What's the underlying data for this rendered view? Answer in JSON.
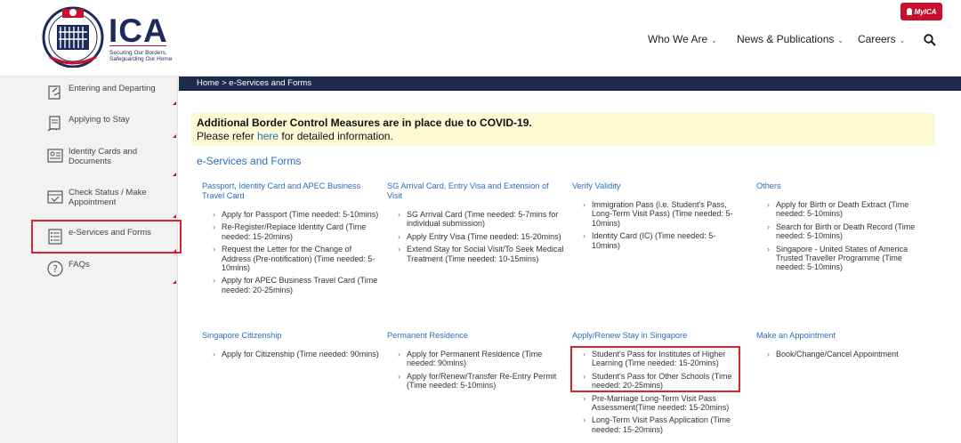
{
  "header": {
    "logo_text": "ICA",
    "tagline": "Securing Our Borders, Safeguarding Our Home",
    "myica_label": "MyICA",
    "nav": [
      {
        "label": "Who We Are"
      },
      {
        "label": "News & Publications"
      },
      {
        "label": "Careers"
      }
    ]
  },
  "sidebar": {
    "items": [
      {
        "label": "Entering and Departing"
      },
      {
        "label": "Applying to Stay"
      },
      {
        "label": "Identity Cards and Documents"
      },
      {
        "label": "Check Status / Make Appointment"
      },
      {
        "label": "e-Services and Forms"
      },
      {
        "label": "FAQs"
      }
    ]
  },
  "breadcrumb": "Home > e-Services and Forms",
  "alert": {
    "title": "Additional Border Control Measures are in place due to COVID-19.",
    "prefix": "Please refer ",
    "link": "here",
    "suffix": " for detailed information."
  },
  "section_title": "e-Services and Forms",
  "columns": [
    {
      "heading": "Passport, Identity Card and APEC Business Travel Card",
      "items": [
        "Apply for Passport (Time needed: 5-10mins)",
        "Re-Register/Replace Identity Card (Time needed: 15-20mins)",
        "Request the Letter for the Change of Address (Pre-notification) (Time needed: 5-10mins)",
        "Apply for APEC Business Travel Card (Time needed: 20-25mins)"
      ]
    },
    {
      "heading": "SG Arrival Card, Entry Visa and Extension of Visit",
      "items": [
        "SG Arrival Card (Time needed: 5-7mins for individual submission)",
        "Apply Entry Visa (Time needed: 15-20mins)",
        "Extend Stay for Social Visit/To Seek Medical Treatment (Time needed: 10-15mins)"
      ]
    },
    {
      "heading": "Verify Validity",
      "items": [
        "Immigration Pass (i.e. Student's Pass, Long-Term Visit Pass) (Time needed: 5-10mins)",
        "Identity Card (IC) (Time needed: 5-10mins)"
      ]
    },
    {
      "heading": "Others",
      "items": [
        "Apply for Birth or Death Extract (Time needed: 5-10mins)",
        "Search for Birth or Death Record (Time needed: 5-10mins)",
        "Singapore - United States of America Trusted Traveller Programme (Time needed: 5-10mins)"
      ]
    },
    {
      "heading": "Singapore Citizenship",
      "items": [
        "Apply for Citizenship (Time needed: 90mins)"
      ]
    },
    {
      "heading": "Permanent Residence",
      "items": [
        "Apply for Permanent Residence (Time needed: 90mins)",
        "Apply for/Renew/Transfer Re-Entry Permit (Time needed: 5-10mins)"
      ]
    },
    {
      "heading": "Apply/Renew Stay in Singapore",
      "items": [
        "Student's Pass for Institutes of Higher Learning (Time needed: 15-20mins)",
        "Student's Pass for Other Schools (Time needed: 20-25mins)",
        "Pre-Marriage Long-Term Visit Pass Assessment(Time needed: 15-20mins)",
        "Long-Term Visit Pass Application (Time needed: 15-20mins)"
      ]
    },
    {
      "heading": "Make an Appointment",
      "items": [
        "Book/Change/Cancel Appointment"
      ]
    }
  ],
  "colors": {
    "brand_navy": "#1c2b5b",
    "accent_red": "#c8102e",
    "link_blue": "#2a6ebb",
    "alert_bg": "#fcf9d3"
  }
}
